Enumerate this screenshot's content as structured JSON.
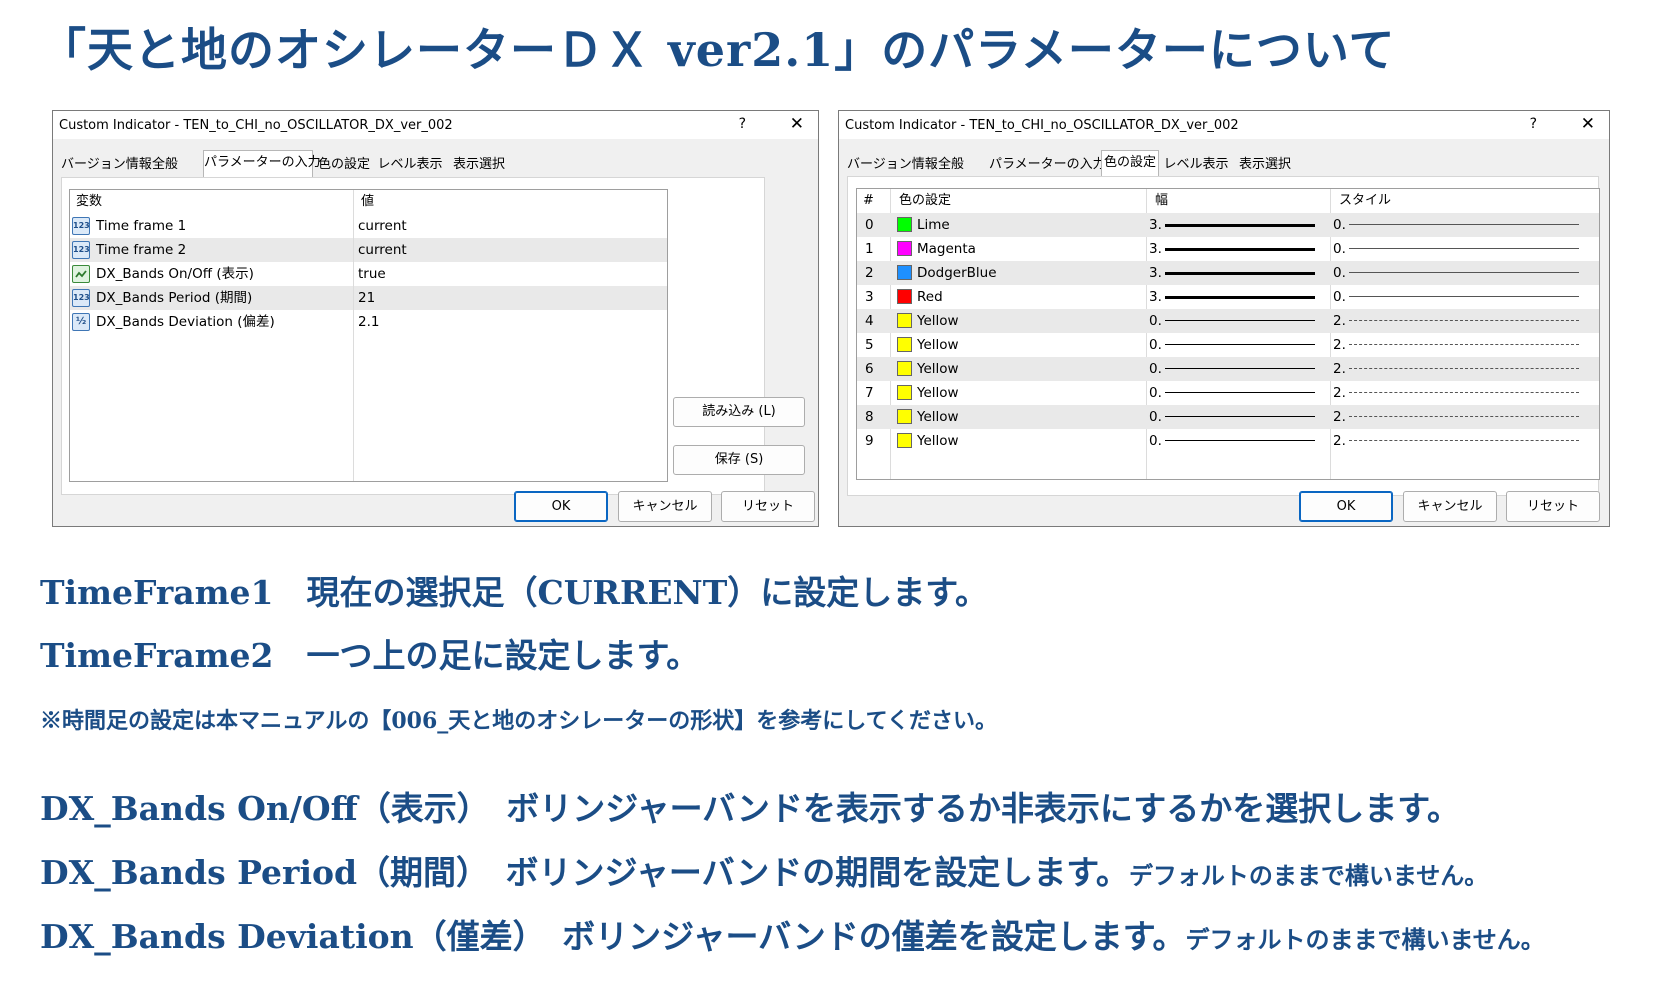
{
  "heading": "「天と地のオシレーターＤＸ ver2.1」のパラメーターについて",
  "dialog1": {
    "title": "Custom Indicator - TEN_to_CHI_no_OSCILLATOR_DX_ver_002",
    "help": "?",
    "close": "✕",
    "tabs": [
      "バージョン情報",
      "全般",
      "パラメーターの入力",
      "色の設定",
      "レベル表示",
      "表示選択"
    ],
    "active_tab": "パラメーターの入力",
    "columns": [
      "変数",
      "値"
    ],
    "rows": [
      {
        "icon": "123",
        "name": "Time frame 1",
        "value": "current"
      },
      {
        "icon": "123",
        "name": "Time frame 2",
        "value": "current"
      },
      {
        "icon": "bool",
        "name": "DX_Bands On/Off (表示)",
        "value": "true"
      },
      {
        "icon": "123",
        "name": "DX_Bands Period (期間)",
        "value": "21"
      },
      {
        "icon": "½",
        "name": "DX_Bands Deviation (偏差)",
        "value": "2.1"
      }
    ],
    "load_button": "読み込み (L)",
    "save_button": "保存 (S)",
    "ok_button": "OK",
    "cancel_button": "キャンセル",
    "reset_button": "リセット"
  },
  "dialog2": {
    "title": "Custom Indicator - TEN_to_CHI_no_OSCILLATOR_DX_ver_002",
    "help": "?",
    "close": "✕",
    "tabs": [
      "バージョン情報",
      "全般",
      "パラメーターの入力",
      "色の設定",
      "レベル表示",
      "表示選択"
    ],
    "active_tab": "色の設定",
    "columns": [
      "#",
      "色の設定",
      "幅",
      "スタイル"
    ],
    "rows": [
      {
        "index": "0",
        "color_name": "Lime",
        "color": "#00ff00",
        "width": "3.",
        "style": "0.",
        "width_line": "thick",
        "style_line": "solid"
      },
      {
        "index": "1",
        "color_name": "Magenta",
        "color": "#ff00ff",
        "width": "3.",
        "style": "0.",
        "width_line": "thick",
        "style_line": "solid"
      },
      {
        "index": "2",
        "color_name": "DodgerBlue",
        "color": "#1e90ff",
        "width": "3.",
        "style": "0.",
        "width_line": "thick",
        "style_line": "solid"
      },
      {
        "index": "3",
        "color_name": "Red",
        "color": "#ff0000",
        "width": "3.",
        "style": "0.",
        "width_line": "thick",
        "style_line": "solid"
      },
      {
        "index": "4",
        "color_name": "Yellow",
        "color": "#ffff00",
        "width": "0.",
        "style": "2.",
        "width_line": "thin",
        "style_line": "dashed"
      },
      {
        "index": "5",
        "color_name": "Yellow",
        "color": "#ffff00",
        "width": "0.",
        "style": "2.",
        "width_line": "thin",
        "style_line": "dashed"
      },
      {
        "index": "6",
        "color_name": "Yellow",
        "color": "#ffff00",
        "width": "0.",
        "style": "2.",
        "width_line": "thin",
        "style_line": "dashed"
      },
      {
        "index": "7",
        "color_name": "Yellow",
        "color": "#ffff00",
        "width": "0.",
        "style": "2.",
        "width_line": "thin",
        "style_line": "dashed"
      },
      {
        "index": "8",
        "color_name": "Yellow",
        "color": "#ffff00",
        "width": "0.",
        "style": "2.",
        "width_line": "thin",
        "style_line": "dashed"
      },
      {
        "index": "9",
        "color_name": "Yellow",
        "color": "#ffff00",
        "width": "0.",
        "style": "2.",
        "width_line": "thin",
        "style_line": "dashed"
      }
    ],
    "ok_button": "OK",
    "cancel_button": "キャンセル",
    "reset_button": "リセット"
  },
  "descriptions": {
    "tf1": "TimeFrame1　現在の選択足（CURRENT）に設定します。",
    "tf2": "TimeFrame2　一つ上の足に設定します。",
    "note": "※時間足の設定は本マニュアルの【006_天と地のオシレーターの形状】を参考にしてください。",
    "onoff": "DX_Bands On/Off（表示）　ボリンジャーバンドを表示するか非表示にするかを選択します。",
    "period": "DX_Bands Period（期間）　ボリンジャーバンドの期間を設定します。",
    "period_small": "デフォルトのままで構いません。",
    "deviation": "DX_Bands Deviation（僅差）　ボリンジャーバンドの僅差を設定します。",
    "deviation_small": "デフォルトのままで構いません。"
  },
  "colors": {
    "accent_text": "#1b4d86",
    "ok_border": "#0a66c2",
    "alt_row": "#e9e9e9"
  }
}
